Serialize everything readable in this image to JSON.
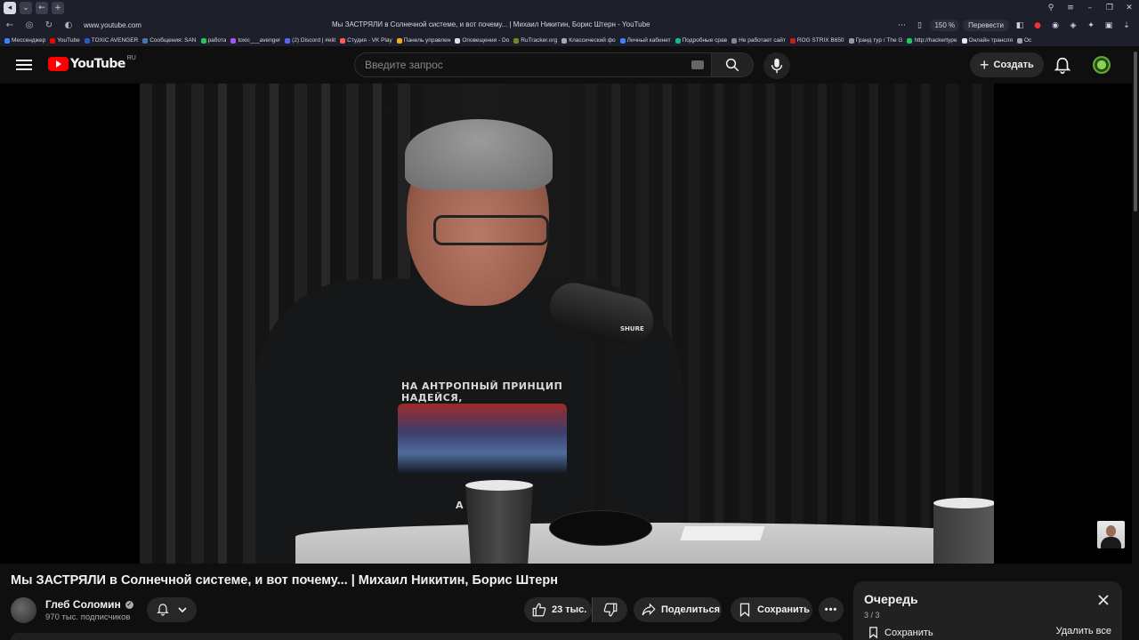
{
  "browser": {
    "url": "www.youtube.com",
    "page_title": "Мы ЗАСТРЯЛИ в Солнечной системе, и вот почему... | Михаил Никитин, Борис Штерн - YouTube",
    "zoom": "150 %",
    "translate_label": "Перевести",
    "bookmarks": [
      {
        "label": "Мессенджер",
        "color": "#3b82f6"
      },
      {
        "label": "YouTube",
        "color": "#ff0000"
      },
      {
        "label": "TOXIC AVENGER",
        "color": "#2b59c3"
      },
      {
        "label": "Сообщения: SAN",
        "color": "#4a76a8"
      },
      {
        "label": "работа",
        "color": "#22c55e"
      },
      {
        "label": "toxic___avenger",
        "color": "#a855f7"
      },
      {
        "label": "(2) Discord | #elit",
        "color": "#5865f2"
      },
      {
        "label": "Студия - VK Play",
        "color": "#ff5a5a"
      },
      {
        "label": "Панель управлен",
        "color": "#f5a623"
      },
      {
        "label": "Оповещения - Do",
        "color": "#e0e0e0"
      },
      {
        "label": "RuTracker.org",
        "color": "#6b8e23"
      },
      {
        "label": "Классический фо",
        "color": "#aaaaaa"
      },
      {
        "label": "Личный кабинет",
        "color": "#3b82f6"
      },
      {
        "label": "Подробные срав",
        "color": "#10b981"
      },
      {
        "label": "Не работает сайт",
        "color": "#888888"
      },
      {
        "label": "ROG STRIX B650",
        "color": "#c81e1e"
      },
      {
        "label": "Гранд тур / The G",
        "color": "#999999"
      },
      {
        "label": "http://hackertype",
        "color": "#22c55e"
      },
      {
        "label": "Онлайн трансля",
        "color": "#e5e7eb"
      },
      {
        "label": "Ос",
        "color": "#9ca3af"
      }
    ]
  },
  "header": {
    "logo_text": "YouTube",
    "country_code": "RU",
    "search_placeholder": "Введите запрос",
    "create_label": "Создать"
  },
  "video": {
    "title": "Мы ЗАСТРЯЛИ в Солнечной системе, и вот почему... | Михаил Никитин, Борис Штерн",
    "shirt_text_top": "НА АНТРОПНЫЙ ПРИНЦИП НАДЕЙСЯ,",
    "shirt_text_bottom": "А       ЛОШАЙ!",
    "mic_brand": "SHURE"
  },
  "channel": {
    "name": "Глеб Соломин",
    "subscribers": "970 тыс. подписчиков"
  },
  "actions": {
    "likes": "23 тыс.",
    "share_label": "Поделиться",
    "save_label": "Сохранить"
  },
  "queue": {
    "title": "Очередь",
    "count": "3 / 3",
    "save_label": "Сохранить",
    "delete_all_label": "Удалить все"
  }
}
